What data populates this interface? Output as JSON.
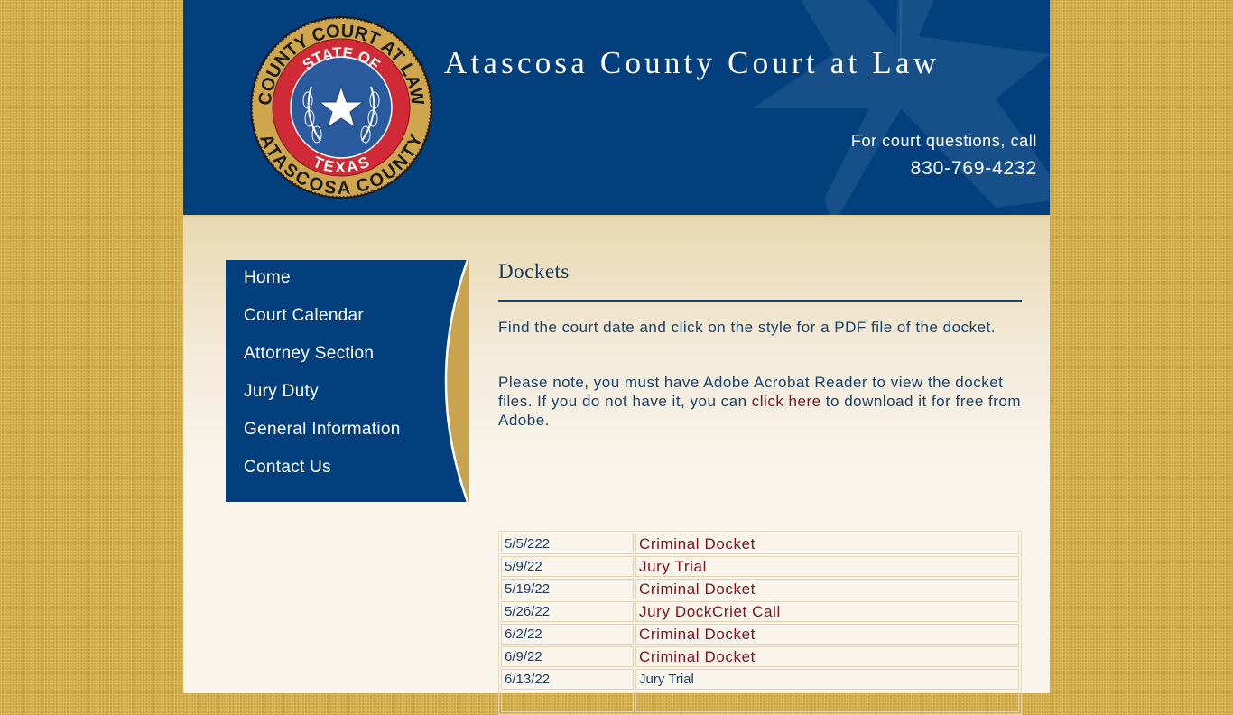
{
  "header": {
    "site_title": "Atascosa County Court at Law",
    "seal": {
      "outer_text_top": "COUNTY COURT AT LAW",
      "outer_text_bottom": "ATASCOSA COUNTY",
      "inner_text_top": "STATE OF",
      "inner_text_bottom": "TEXAS",
      "icon": "texas-star-seal-icon"
    },
    "call_label": "For court questions, call",
    "phone": "830-769-4232"
  },
  "nav": {
    "items": [
      {
        "label": "Home"
      },
      {
        "label": "Court Calendar"
      },
      {
        "label": "Attorney Section"
      },
      {
        "label": "Jury Duty"
      },
      {
        "label": "General Information"
      },
      {
        "label": "Contact Us"
      }
    ]
  },
  "content": {
    "title": "Dockets",
    "intro": "Find the court date and click on the style for a PDF file of the docket.",
    "note_before": "Please note, you must have Adobe Acrobat Reader to view the docket files. If you do not have it, you can ",
    "note_link": "click here",
    "note_after": " to download it for free from Adobe."
  },
  "dockets": [
    {
      "date": "5/5/222",
      "style": "Criminal Docket"
    },
    {
      "date": "5/9/22",
      "style": "Jury Trial"
    },
    {
      "date": "5/19/22",
      "style": "Criminal Docket"
    },
    {
      "date": "5/26/22",
      "style": "Jury DockCriet Call"
    },
    {
      "date": "6/2/22",
      "style": "Criminal Docket"
    },
    {
      "date": "6/9/22",
      "style": "Criminal Docket"
    },
    {
      "date": "6/13/22",
      "style": "Jury Trial"
    }
  ],
  "colors": {
    "brand_blue": "#023f7c",
    "gold": "#cfa947",
    "link_red": "#7c1222",
    "text_blue": "#17416a"
  }
}
